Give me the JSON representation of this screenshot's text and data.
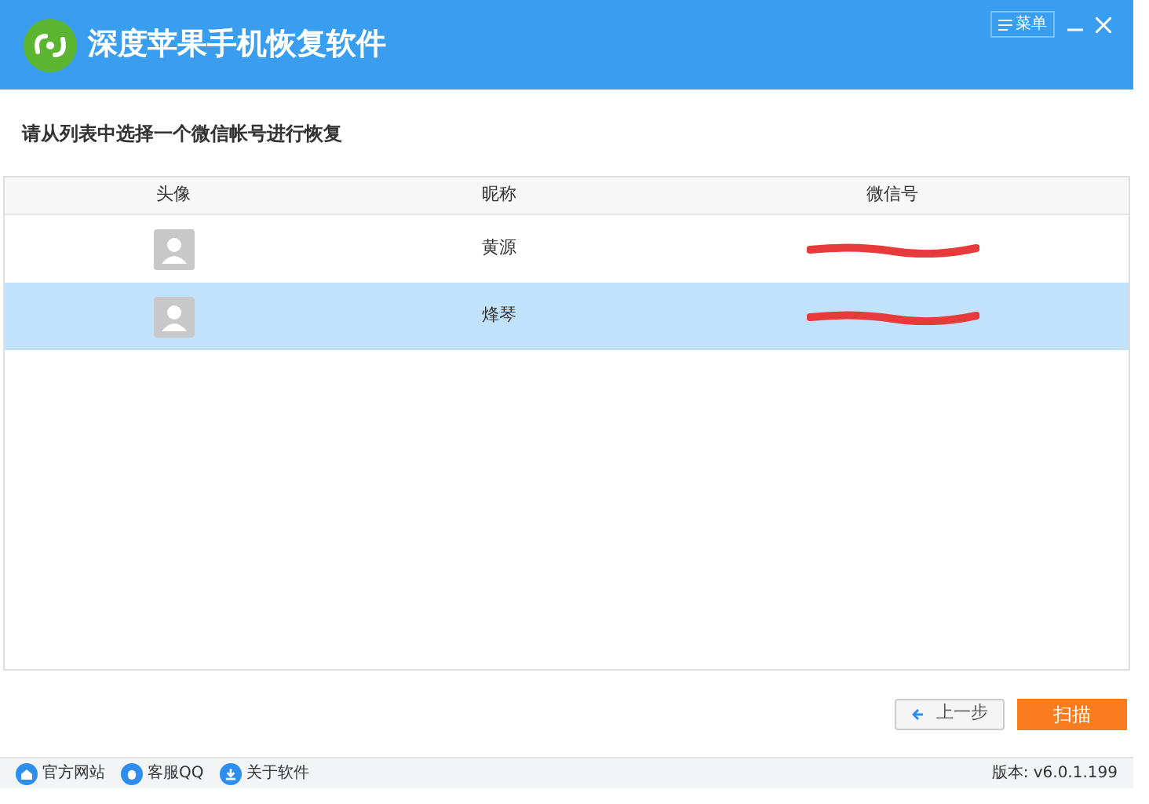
{
  "window": {
    "title": "深度苹果手机恢复软件",
    "menu_button": "菜单"
  },
  "prompt": "请从列表中选择一个微信帐号进行恢复",
  "table": {
    "columns": [
      "头像",
      "昵称",
      "微信号"
    ],
    "rows": [
      {
        "nickname": "黄源",
        "selected": false
      },
      {
        "nickname": "烽琴",
        "selected": true
      }
    ]
  },
  "buttons": {
    "back": "上一步",
    "scan": "扫描"
  },
  "footer": {
    "links": [
      {
        "label": "官方网站",
        "kind": "home"
      },
      {
        "label": "客服QQ",
        "kind": "qq"
      },
      {
        "label": "关于软件",
        "kind": "about"
      }
    ],
    "version": "版本: v6.0.1.199"
  }
}
